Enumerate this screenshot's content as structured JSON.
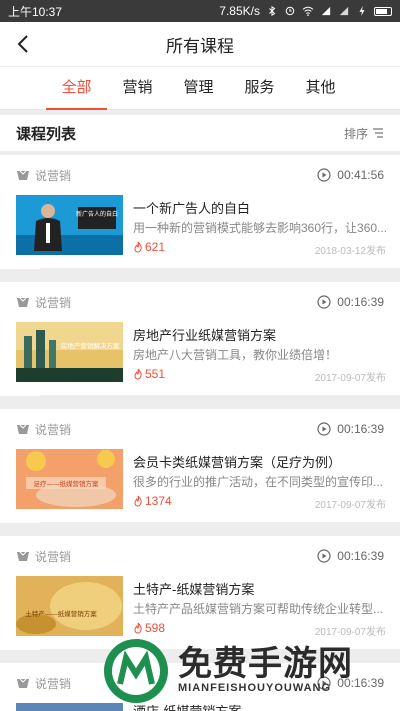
{
  "statusbar": {
    "time": "上午10:37",
    "speed": "7.85K/s"
  },
  "header": {
    "title": "所有课程"
  },
  "tabs": [
    {
      "label": "全部",
      "active": true
    },
    {
      "label": "营销"
    },
    {
      "label": "管理"
    },
    {
      "label": "服务"
    },
    {
      "label": "其他"
    }
  ],
  "list": {
    "title": "课程列表",
    "sort_label": "排序"
  },
  "courses": [
    {
      "category": "说营销",
      "duration": "00:41:56",
      "title": "一个新广告人的自白",
      "desc": "用一种新的营销模式能够去影响360行，让360...",
      "hot": "621",
      "date": "2018-03-12发布",
      "thumb_text": "新广告人的自白"
    },
    {
      "category": "说营销",
      "duration": "00:16:39",
      "title": "房地产行业纸媒营销方案",
      "desc": "房地产八大营销工具，教你业绩倍增！",
      "hot": "551",
      "date": "2017-09-07发布",
      "thumb_text": "房地产营销解决方案"
    },
    {
      "category": "说营销",
      "duration": "00:16:39",
      "title": "会员卡类纸媒营销方案（足疗为例）",
      "desc": "很多的行业的推广活动，在不同类型的宣传印...",
      "hot": "1374",
      "date": "2017-09-07发布",
      "thumb_text": "足疗——纸媒营销方案"
    },
    {
      "category": "说营销",
      "duration": "00:16:39",
      "title": "土特产-纸媒营销方案",
      "desc": "土特产产品纸媒营销方案可帮助传统企业转型...",
      "hot": "598",
      "date": "2017-09-07发布",
      "thumb_text": "土特产——纸媒营销方案"
    },
    {
      "category": "说营销",
      "duration": "00:16:39",
      "title": "酒店-纸媒营销方案",
      "desc": "",
      "hot": "",
      "date": "",
      "thumb_text": ""
    }
  ],
  "watermark": {
    "title": "免费手游网",
    "subtitle": "MIANFEISHOUYOUWANG"
  },
  "colors": {
    "accent": "#f24e3a"
  }
}
